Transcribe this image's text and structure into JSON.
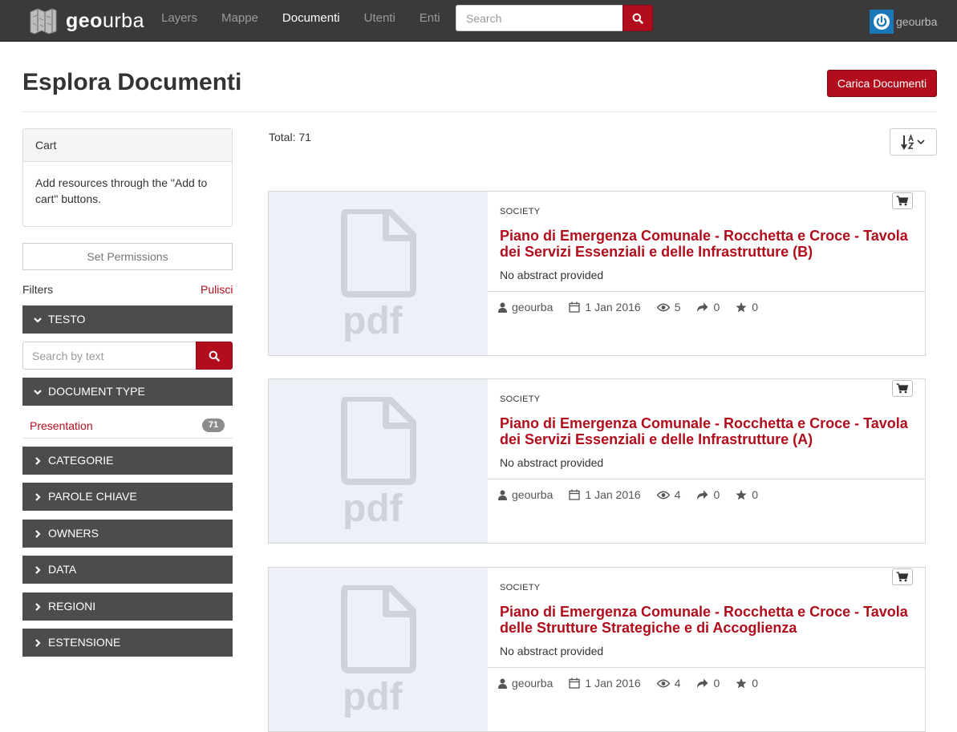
{
  "navbar": {
    "logo_bold": "geo",
    "logo_light": "urba",
    "links": [
      {
        "label": "Layers",
        "active": false
      },
      {
        "label": "Mappe",
        "active": false
      },
      {
        "label": "Documenti",
        "active": true
      },
      {
        "label": "Utenti",
        "active": false
      },
      {
        "label": "Enti",
        "active": false
      }
    ],
    "search_placeholder": "Search",
    "user_name": "geourba"
  },
  "header": {
    "title": "Esplora Documenti",
    "upload_label": "Carica Documenti"
  },
  "sidebar": {
    "cart_title": "Cart",
    "cart_text": "Add resources through the \"Add to cart\" buttons.",
    "permissions_label": "Set Permissions",
    "filters_label": "Filters",
    "clear_label": "Pulisci",
    "text_search_placeholder": "Search by text",
    "facets": [
      {
        "label": "TESTO",
        "expanded": true
      },
      {
        "label": "DOCUMENT TYPE",
        "expanded": true
      },
      {
        "label": "CATEGORIE",
        "expanded": false
      },
      {
        "label": "PAROLE CHIAVE",
        "expanded": false
      },
      {
        "label": "OWNERS",
        "expanded": false
      },
      {
        "label": "DATA",
        "expanded": false
      },
      {
        "label": "REGIONI",
        "expanded": false
      },
      {
        "label": "ESTENSIONE",
        "expanded": false
      }
    ],
    "doc_type_item": {
      "label": "Presentation",
      "count": "71"
    }
  },
  "results": {
    "total_label": "Total: 71",
    "thumb_label": "pdf",
    "cards": [
      {
        "category": "SOCIETY",
        "title": "Piano di Emergenza Comunale - Rocchetta e Croce - Tavola dei Servizi Essenziali e delle Infrastrutture (B)",
        "abstract": "No abstract provided",
        "owner": "geourba",
        "date": "1 Jan 2016",
        "views": "5",
        "shares": "0",
        "rating": "0"
      },
      {
        "category": "SOCIETY",
        "title": "Piano di Emergenza Comunale - Rocchetta e Croce - Tavola dei Servizi Essenziali e delle Infrastrutture (A)",
        "abstract": "No abstract provided",
        "owner": "geourba",
        "date": "1 Jan 2016",
        "views": "4",
        "shares": "0",
        "rating": "0"
      },
      {
        "category": "SOCIETY",
        "title": "Piano di Emergenza Comunale - Rocchetta e Croce - Tavola delle Strutture Strategiche e di Accoglienza",
        "abstract": "No abstract provided",
        "owner": "geourba",
        "date": "1 Jan 2016",
        "views": "4",
        "shares": "0",
        "rating": "0"
      }
    ]
  },
  "colors": {
    "navbar_bg": "#3a3a3a",
    "brand_red": "#b10d1c",
    "facet_bg": "#4c4c4c",
    "thumb_bg": "#eef0f7"
  }
}
